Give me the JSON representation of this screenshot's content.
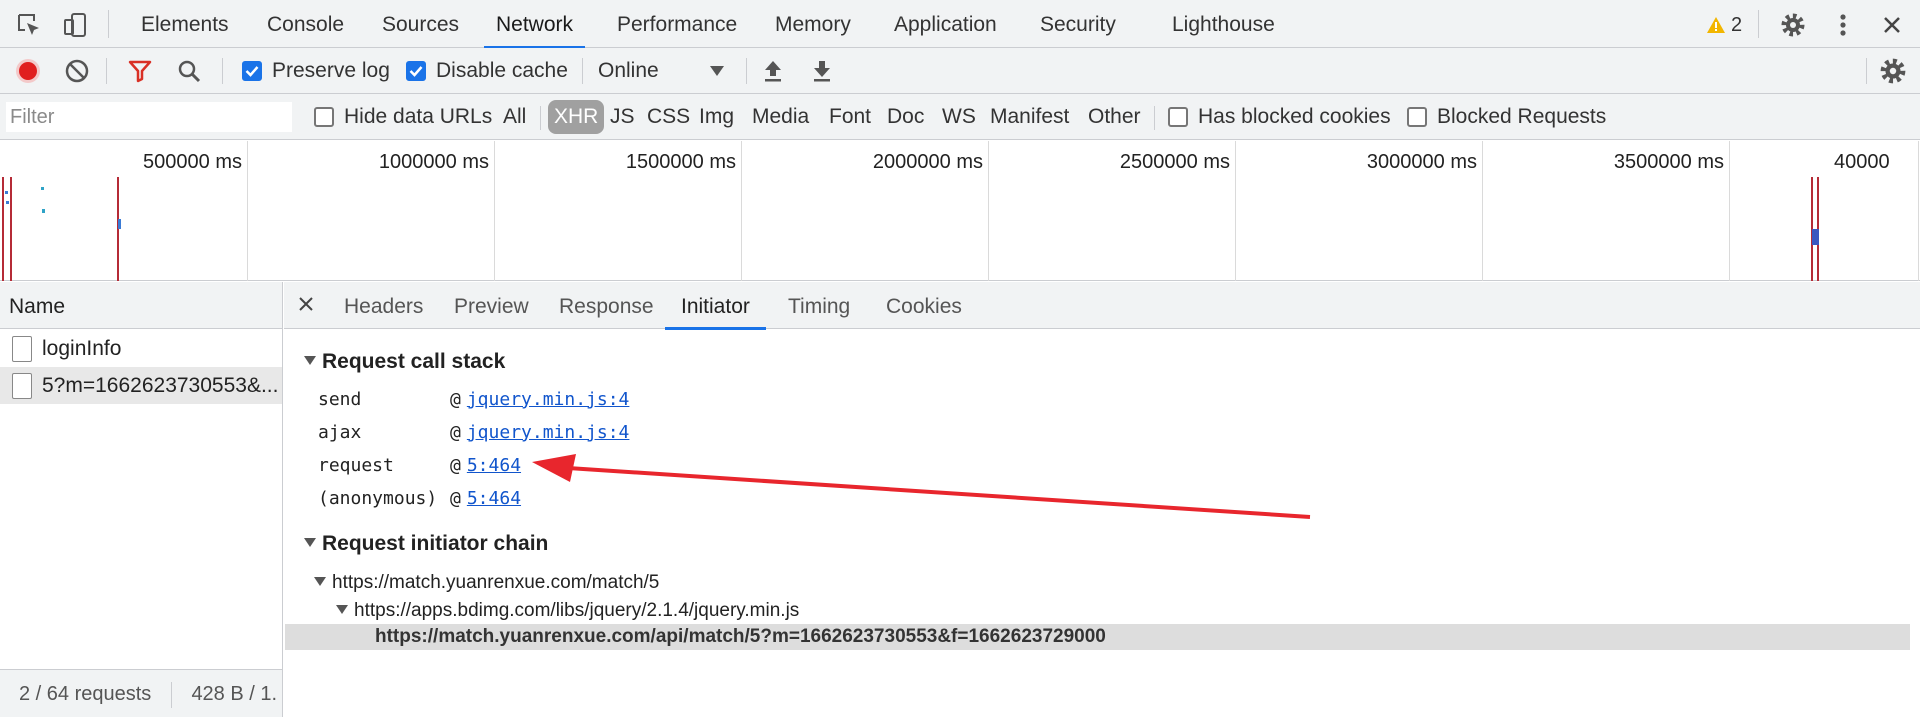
{
  "main_tabs": [
    {
      "label": "Elements"
    },
    {
      "label": "Console"
    },
    {
      "label": "Sources"
    },
    {
      "label": "Network",
      "active": true
    },
    {
      "label": "Performance"
    },
    {
      "label": "Memory"
    },
    {
      "label": "Application"
    },
    {
      "label": "Security"
    },
    {
      "label": "Lighthouse"
    }
  ],
  "warnings": {
    "count": "2",
    "icon": "warning-triangle-icon",
    "color": "#f2b600"
  },
  "toolbar": {
    "preserve_log": {
      "label": "Preserve log",
      "checked": true
    },
    "disable_cache": {
      "label": "Disable cache",
      "checked": true
    },
    "throttling": {
      "value": "Online"
    }
  },
  "filter": {
    "placeholder": "Filter",
    "hide_data_urls": {
      "label": "Hide data URLs",
      "checked": false
    },
    "types": [
      "All",
      "XHR",
      "JS",
      "CSS",
      "Img",
      "Media",
      "Font",
      "Doc",
      "WS",
      "Manifest",
      "Other"
    ],
    "active_type": "XHR",
    "has_blocked_cookies": {
      "label": "Has blocked cookies",
      "checked": false
    },
    "blocked_requests": {
      "label": "Blocked Requests",
      "checked": false
    }
  },
  "overview": {
    "labels": [
      "500000 ms",
      "1000000 ms",
      "1500000 ms",
      "2000000 ms",
      "2500000 ms",
      "3000000 ms",
      "3500000 ms",
      "40000"
    ]
  },
  "requests": {
    "header": "Name",
    "items": [
      {
        "name": "loginInfo",
        "selected": false
      },
      {
        "name": "5?m=1662623730553&...",
        "selected": true
      }
    ],
    "status": {
      "count": "2 / 64 requests",
      "size": "428 B / 1."
    }
  },
  "detail": {
    "tabs": [
      {
        "label": "Headers"
      },
      {
        "label": "Preview"
      },
      {
        "label": "Response"
      },
      {
        "label": "Initiator",
        "active": true
      },
      {
        "label": "Timing"
      },
      {
        "label": "Cookies"
      }
    ],
    "call_stack": {
      "title": "Request call stack",
      "frames": [
        {
          "fn": "send",
          "at": "@",
          "link": "jquery.min.js:4"
        },
        {
          "fn": "ajax",
          "at": "@",
          "link": "jquery.min.js:4"
        },
        {
          "fn": "request",
          "at": "@",
          "link": "5:464"
        },
        {
          "fn": "(anonymous)",
          "at": "@",
          "link": "5:464"
        }
      ]
    },
    "initiator_chain": {
      "title": "Request initiator chain",
      "items": [
        {
          "url": "https://match.yuanrenxue.com/match/5",
          "level": 0
        },
        {
          "url": "https://apps.bdimg.com/libs/jquery/2.1.4/jquery.min.js",
          "level": 1
        },
        {
          "url": "https://match.yuanrenxue.com/api/match/5?m=1662623730553&f=1662623729000",
          "level": 2
        }
      ]
    }
  },
  "annotation": {
    "color": "#e8262d"
  }
}
